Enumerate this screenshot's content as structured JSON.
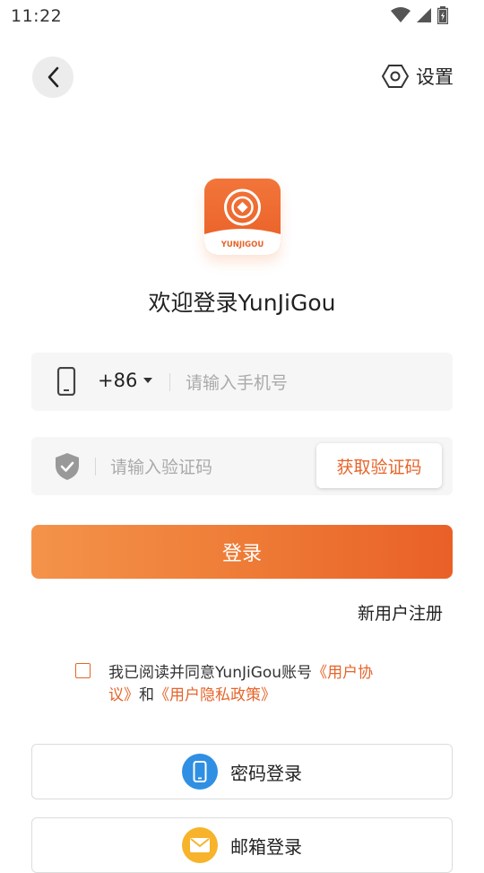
{
  "status_bar": {
    "time": "11:22"
  },
  "header": {
    "settings_label": "设置"
  },
  "logo": {
    "brand_text": "YUNJIGOU"
  },
  "welcome": "欢迎登录YunJiGou",
  "phone": {
    "country_code": "+86",
    "placeholder": "请输入手机号"
  },
  "code": {
    "placeholder": "请输入验证码",
    "get_code_label": "获取验证码"
  },
  "login_label": "登录",
  "register_label": "新用户注册",
  "agreement": {
    "line1_text": "我已阅读并同意YunJiGou账号",
    "user_agreement_part1": "《用户协",
    "user_agreement_part2": "议》",
    "and": "和",
    "privacy_policy": "《用户隐私政策》"
  },
  "alt_login": {
    "password_label": "密码登录",
    "email_label": "邮箱登录"
  },
  "colors": {
    "accent": "#e6642a",
    "blue_icon": "#2f8fe3",
    "orange_icon": "#f7b32b"
  }
}
